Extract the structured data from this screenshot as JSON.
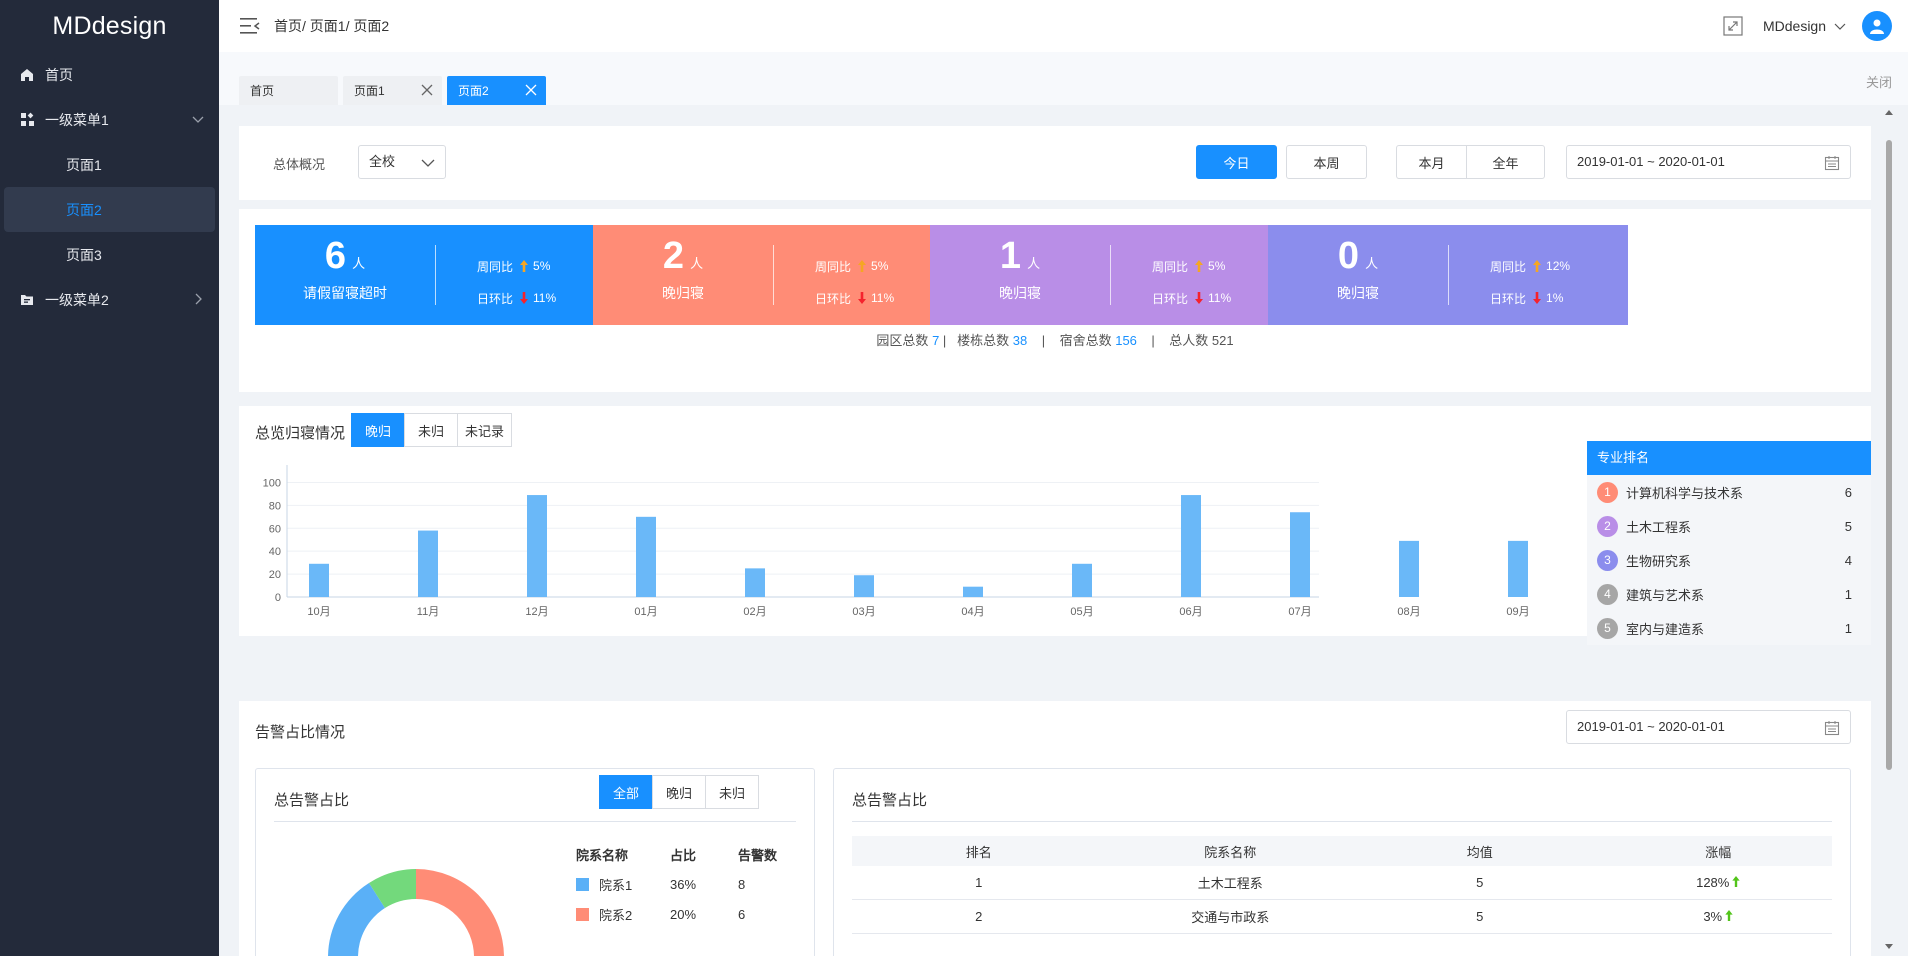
{
  "app": {
    "logo": "MDdesign"
  },
  "sidebar": {
    "items": [
      {
        "label": "首页",
        "icon": "home-icon"
      },
      {
        "label": "一级菜单1",
        "icon": "widgets-icon",
        "expanded": true,
        "children": [
          {
            "label": "页面1"
          },
          {
            "label": "页面2",
            "active": true
          },
          {
            "label": "页面3"
          }
        ]
      },
      {
        "label": "一级菜单2",
        "icon": "folder-icon",
        "expanded": false
      }
    ]
  },
  "header": {
    "breadcrumb": "首页/ 页面1/ 页面2",
    "user": "MDdesign"
  },
  "tabs": {
    "items": [
      {
        "label": "首页"
      },
      {
        "label": "页面1"
      },
      {
        "label": "页面2",
        "active": true
      }
    ],
    "close_all": "关闭"
  },
  "filters": {
    "overview_label": "总体概况",
    "scope": "全校",
    "btn_today": "今日",
    "btn_week": "本周",
    "btn_month": "本月",
    "btn_year": "全年",
    "date_range": "2019-01-01 ~ 2020-01-01"
  },
  "stats": {
    "unit": "人",
    "cards": [
      {
        "value": "6",
        "desc": "请假留寝超时",
        "wow_label": "周同比",
        "wow": "5%",
        "dod_label": "日环比",
        "dod": "11%",
        "color": "#1890ff"
      },
      {
        "value": "2",
        "desc": "晚归寝",
        "wow_label": "周同比",
        "wow": "5%",
        "dod_label": "日环比",
        "dod": "11%",
        "color": "#ff8c76"
      },
      {
        "value": "1",
        "desc": "晚归寝",
        "wow_label": "周同比",
        "wow": "5%",
        "dod_label": "日环比",
        "dod": "11%",
        "color": "#b98ee7"
      },
      {
        "value": "0",
        "desc": "晚归寝",
        "wow_label": "周同比",
        "wow": "12%",
        "dod_label": "日环比",
        "dod": "1%",
        "color": "#8b8ded"
      }
    ],
    "summary": {
      "park_label": "园区总数",
      "park": "7",
      "building_label": "楼栋总数",
      "building": "38",
      "dorm_label": "宿舍总数",
      "dorm": "156",
      "people_label": "总人数",
      "people": "521"
    }
  },
  "return_section": {
    "title": "总览归寝情况",
    "seg": [
      "晚归",
      "未归",
      "未记录"
    ],
    "ranking_title": "专业排名",
    "ranking": [
      {
        "rank": "1",
        "name": "计算机科学与技术系",
        "value": "6",
        "color": "#ff8c76"
      },
      {
        "rank": "2",
        "name": "土木工程系",
        "value": "5",
        "color": "#b98ee7"
      },
      {
        "rank": "3",
        "name": "生物研究系",
        "value": "4",
        "color": "#8b8ded"
      },
      {
        "rank": "4",
        "name": "建筑与艺术系",
        "value": "1",
        "color": "#a6a6a6"
      },
      {
        "rank": "5",
        "name": "室内与建造系",
        "value": "1",
        "color": "#a6a6a6"
      }
    ]
  },
  "chart_data": {
    "type": "bar",
    "categories": [
      "10月",
      "11月",
      "12月",
      "01月",
      "02月",
      "03月",
      "04月",
      "05月",
      "06月",
      "07月",
      "08月",
      "09月"
    ],
    "values": [
      29,
      58,
      89,
      70,
      25,
      19,
      9,
      29,
      89,
      74,
      49,
      49
    ],
    "yticks": [
      0,
      20,
      40,
      60,
      80,
      100
    ],
    "ylim": [
      0,
      110
    ],
    "color": "#6ab8f8",
    "grid": true
  },
  "alert_section": {
    "title": "告警占比情况",
    "date_range": "2019-01-01 ~ 2020-01-01",
    "left": {
      "title": "总告警占比",
      "seg": [
        "全部",
        "晚归",
        "未归"
      ],
      "legend_headers": [
        "院系名称",
        "占比",
        "告警数"
      ],
      "legend_rows": [
        {
          "name": "院系1",
          "pct": "36%",
          "count": "8",
          "color": "#5ab0f7"
        },
        {
          "name": "院系2",
          "pct": "20%",
          "count": "6",
          "color": "#ff8c76"
        }
      ]
    },
    "right": {
      "title": "总告警占比",
      "headers": [
        "排名",
        "院系名称",
        "均值",
        "涨幅"
      ],
      "rows": [
        {
          "rank": "1",
          "name": "土木工程系",
          "avg": "5",
          "growth": "128%"
        },
        {
          "rank": "2",
          "name": "交通与市政系",
          "avg": "5",
          "growth": "3%"
        }
      ]
    }
  },
  "colors": {
    "accent": "#1890ff",
    "sidebar": "#232a3a",
    "up_arrow": "#f5a623",
    "down_arrow": "#f5222d",
    "growth_arrow": "#52c41a"
  }
}
